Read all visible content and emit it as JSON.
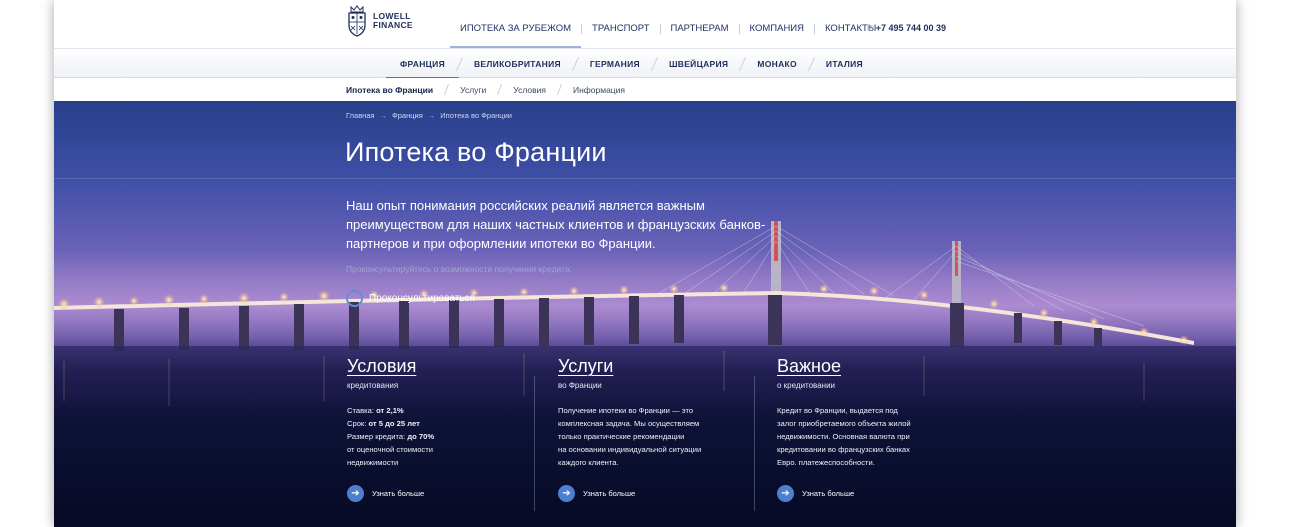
{
  "header": {
    "logo_text_line1": "LOWELL",
    "logo_text_line2": "FINANCE",
    "nav": [
      {
        "label": "ИПОТЕКА ЗА РУБЕЖОМ",
        "active": true
      },
      {
        "label": "ТРАНСПОРТ"
      },
      {
        "label": "ПАРТНЕРАМ"
      },
      {
        "label": "КОМПАНИЯ"
      },
      {
        "label": "КОНТАКТЫ"
      }
    ],
    "phone": "+7 495 744 00 39"
  },
  "countries": [
    {
      "label": "ФРАНЦИЯ",
      "active": true
    },
    {
      "label": "ВЕЛИКОБРИТАНИЯ"
    },
    {
      "label": "ГЕРМАНИЯ"
    },
    {
      "label": "ШВЕЙЦАРИЯ"
    },
    {
      "label": "МОНАКО"
    },
    {
      "label": "ИТАЛИЯ"
    }
  ],
  "subnav": [
    "Ипотека во Франции",
    "Услуги",
    "Условия",
    "Информация"
  ],
  "breadcrumb": [
    "Главная",
    "Франция",
    "Ипотека во Франции"
  ],
  "breadcrumb_sep": "→",
  "hero": {
    "title": "Ипотека во Франции",
    "lead": "Наш опыт понимания российских реалий является важным преимуществом для наших частных клиентов и французских банков-партнеров и при оформлении ипотеки во Франции.",
    "consult_text": "Проконсультируйтесь о возможности получения кредита:",
    "consult_button": "Проконсультироваться"
  },
  "columns": [
    {
      "title": "Условия",
      "subtitle": "кредитования",
      "lines": [
        {
          "text": "Ставка: ",
          "bold": "от 2,1%"
        },
        {
          "text": "Срок: ",
          "bold": "от 5 до 25 лет"
        },
        {
          "text": "Размер кредита: ",
          "bold": "до 70%"
        },
        {
          "text": "от оценочной стоимости",
          "bold": ""
        },
        {
          "text": "недвижимости",
          "bold": ""
        }
      ],
      "more": "Узнать больше"
    },
    {
      "title": "Услуги",
      "subtitle": "во Франции",
      "lines": [
        {
          "text": "Получение ипотеки во Франции — это",
          "bold": ""
        },
        {
          "text": "комплексная задача. Мы осуществляем",
          "bold": ""
        },
        {
          "text": "только практические рекомендации",
          "bold": ""
        },
        {
          "text": "на основании индивидуальной ситуации",
          "bold": ""
        },
        {
          "text": "каждого клиента.",
          "bold": ""
        }
      ],
      "more": "Узнать больше"
    },
    {
      "title": "Важное",
      "subtitle": "о кредитовании",
      "lines": [
        {
          "text": "Кредит во Франции, выдается под",
          "bold": ""
        },
        {
          "text": "залог приобретаемого объекта жилой",
          "bold": ""
        },
        {
          "text": "недвижимости. Основная валюта при",
          "bold": ""
        },
        {
          "text": "кредитовании во французских банках",
          "bold": ""
        },
        {
          "text": "Евро.  платежеспособности.",
          "bold": ""
        }
      ],
      "more": "Узнать больше"
    }
  ],
  "colors": {
    "brand_navy": "#1f2f5c",
    "accent_blue": "#4c7fd0",
    "active_underline": "#3d7bd0"
  }
}
